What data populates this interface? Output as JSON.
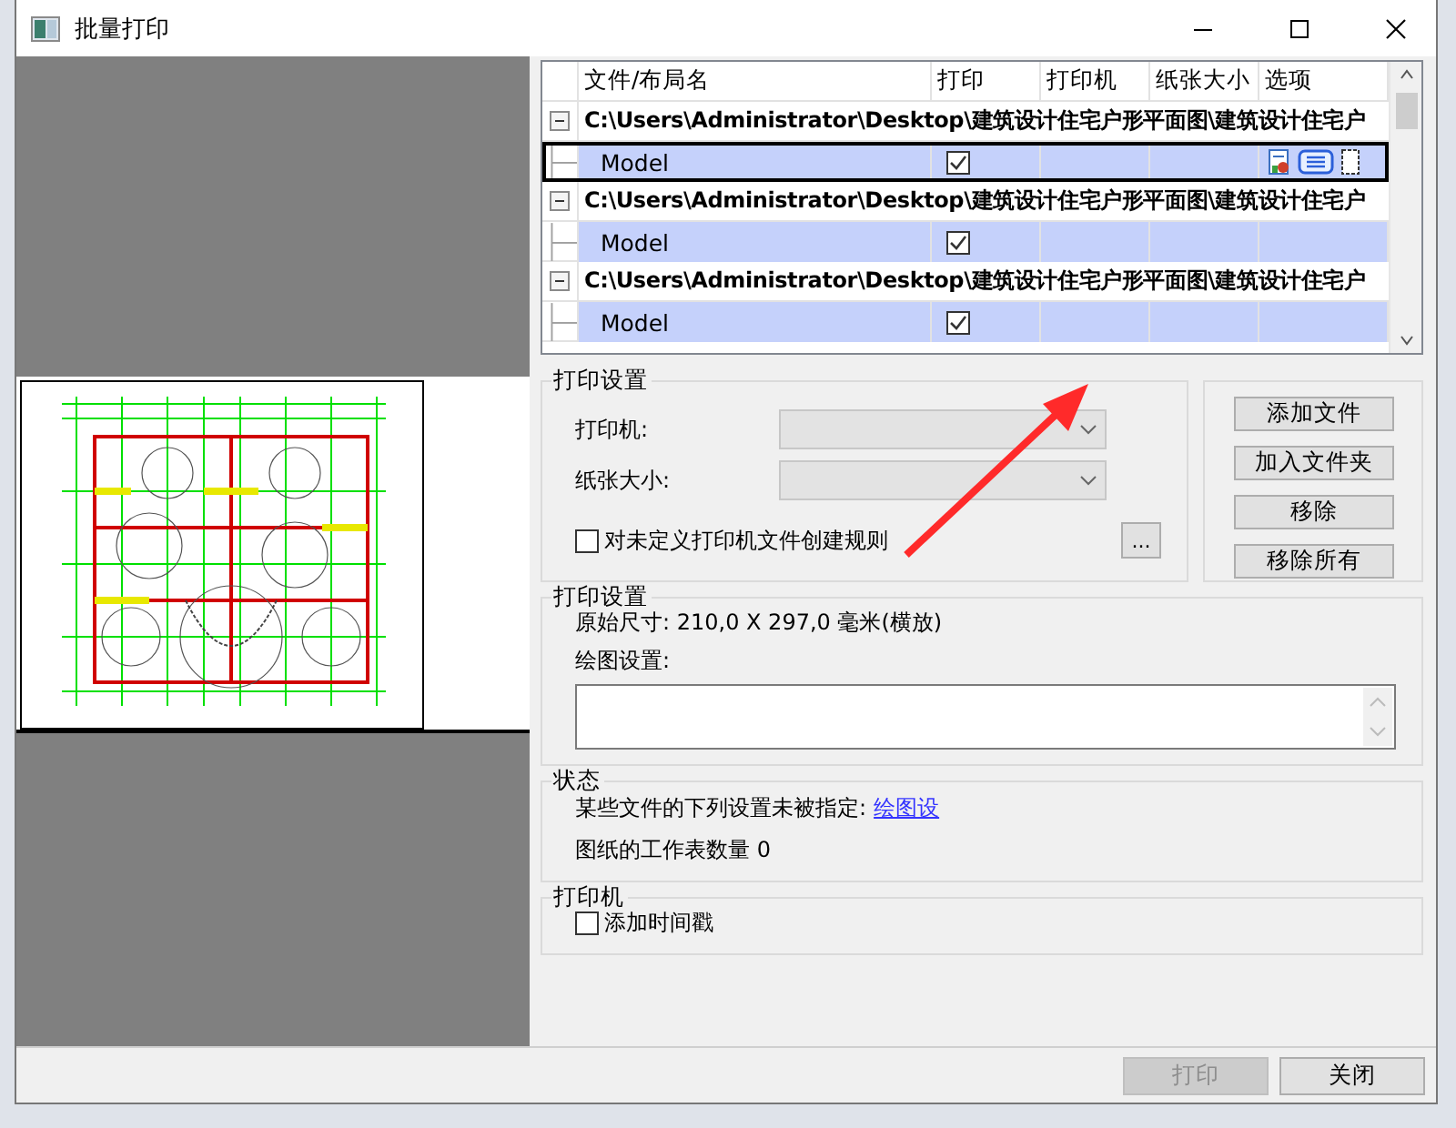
{
  "window": {
    "title": "批量打印"
  },
  "table": {
    "columns": [
      "文件/布局名",
      "打印",
      "打印机",
      "纸张大小",
      "选项"
    ],
    "rows": [
      {
        "kind": "file",
        "name": "C:\\Users\\Administrator\\Desktop\\建筑设计住宅户形平面图\\建筑设计住宅户",
        "expanded": true,
        "selected": false
      },
      {
        "kind": "layout",
        "name": "Model",
        "print": true,
        "selected": true,
        "focused": true
      },
      {
        "kind": "file",
        "name": "C:\\Users\\Administrator\\Desktop\\建筑设计住宅户形平面图\\建筑设计住宅户",
        "expanded": true,
        "selected": false
      },
      {
        "kind": "layout",
        "name": "Model",
        "print": true,
        "selected": true,
        "focused": false
      },
      {
        "kind": "file",
        "name": "C:\\Users\\Administrator\\Desktop\\建筑设计住宅户形平面图\\建筑设计住宅户",
        "expanded": true,
        "selected": false
      },
      {
        "kind": "layout",
        "name": "Model",
        "print": true,
        "selected": true,
        "focused": false
      }
    ]
  },
  "print_settings": {
    "title": "打印设置",
    "printer_label": "打印机:",
    "paper_label": "纸张大小:",
    "rule_checkbox": {
      "label": "对未定义打印机文件创建规则",
      "checked": false
    },
    "browse_button": "..."
  },
  "file_buttons": [
    "添加文件",
    "加入文件夹",
    "移除",
    "移除所有"
  ],
  "page_settings": {
    "title": "打印设置",
    "original_size": "原始尺寸: 210,0 X 297,0 毫米(横放)",
    "plot_settings_label": "绘图设置:"
  },
  "status": {
    "title": "状态",
    "unspecified_text": "某些文件的下列设置未被指定:",
    "unspecified_link": "绘图设",
    "sheet_count": "图纸的工作表数量 0"
  },
  "printer": {
    "title": "打印机",
    "timestamp_checkbox": {
      "label": "添加时间戳",
      "checked": false
    }
  },
  "footer_buttons": [
    {
      "label": "打印",
      "disabled": true
    },
    {
      "label": "关闭",
      "disabled": false
    }
  ]
}
